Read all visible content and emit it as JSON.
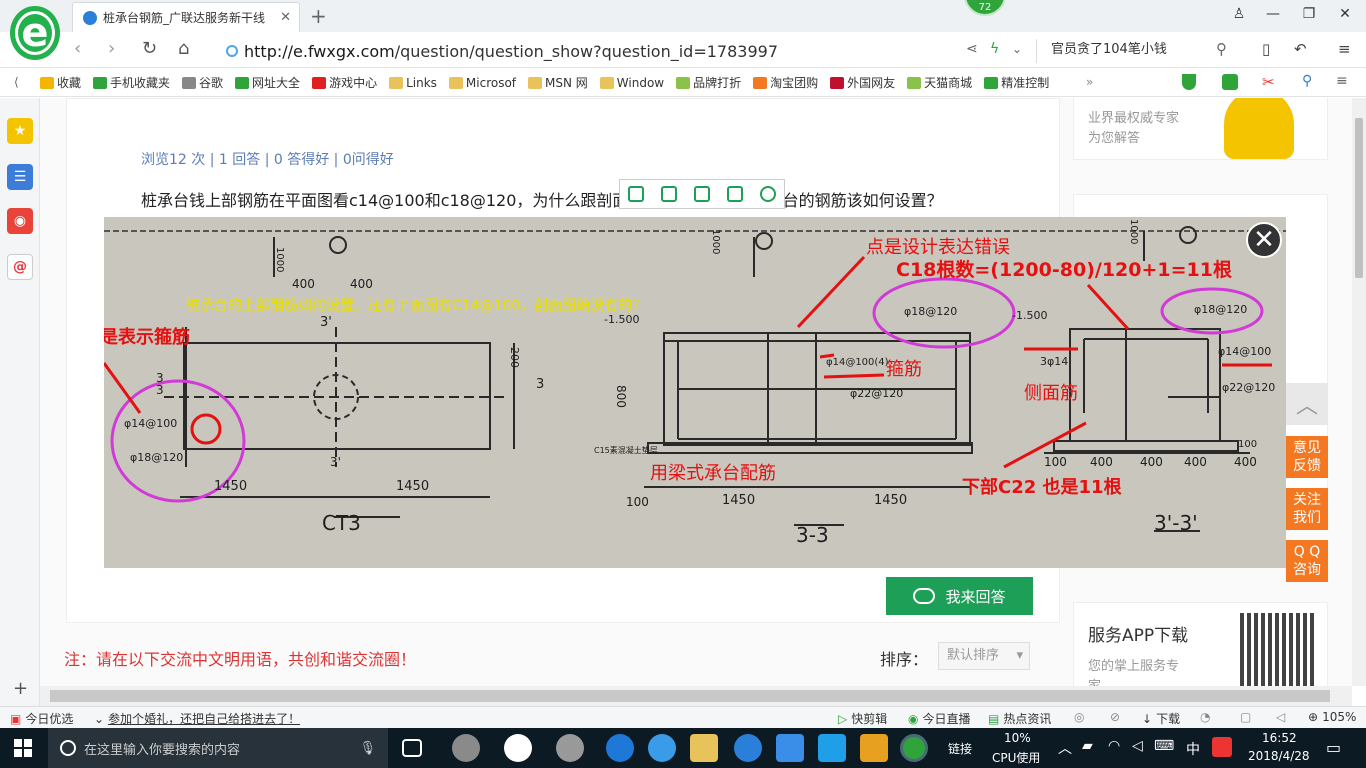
{
  "browser": {
    "tab_title": "桩承台钢筋_广联达服务新干线",
    "badge": "72",
    "url_host": "http://e.fwxgx.com",
    "url_path": "/question/question_show?question_id=1783997",
    "hot_search": "官员贪了104笔小钱"
  },
  "bookmarks": [
    {
      "label": "收藏",
      "color": "#f5b400"
    },
    {
      "label": "手机收藏夹",
      "color": "#2fa43b"
    },
    {
      "label": "谷歌",
      "color": "#888888"
    },
    {
      "label": "网址大全",
      "color": "#2fa43b"
    },
    {
      "label": "游戏中心",
      "color": "#e02020"
    },
    {
      "label": "Links",
      "color": "#e8c25a"
    },
    {
      "label": "Microsof",
      "color": "#e8c25a"
    },
    {
      "label": "MSN 网",
      "color": "#e8c25a"
    },
    {
      "label": "Window",
      "color": "#e8c25a"
    },
    {
      "label": "品牌打折",
      "color": "#8bc34a"
    },
    {
      "label": "淘宝团购",
      "color": "#f37821"
    },
    {
      "label": "外国网友",
      "color": "#c0102c"
    },
    {
      "label": "天猫商城",
      "color": "#8bc34a"
    },
    {
      "label": "精准控制",
      "color": "#2fa43b"
    }
  ],
  "question": {
    "stats": "浏览12 次 | 1 回答 | 0 答得好 | 0问得好",
    "text_left": "桩承台钱上部钢筋在平面图看c14@100和c18@120，为什么跟剖面",
    "text_right": "承台的钢筋该如何设置？",
    "answer_button": "我来回答",
    "notice": "注：请在以下交流中文明用语，共创和谐交流圈！",
    "sort_label": "排序：",
    "sort_value": "默认排序"
  },
  "right_panel": {
    "expert_line1": "业界最权威专家",
    "expert_line2": "为您解答",
    "app_title": "服务APP下载",
    "app_sub": "您的掌上服务专",
    "app_sub2": "家"
  },
  "viewer": {
    "question_banner": "桩承台的上部钢筋如何设置，还有平面图有C14@100，剖面图确没有的？",
    "annotations": {
      "stirrup_note": "这是表示箍筋",
      "design_error": "点是设计表达错误",
      "c18_count": "C18根数=(1200-80)/120+1=11根",
      "stirrup": "箍筋",
      "side_bar": "侧面筋",
      "beam_style": "用梁式承台配筋",
      "bottom_c22": "下部C22 也是11根"
    },
    "drawing_labels": {
      "d1000_a": "1000",
      "d400a": "400",
      "d400b": "400",
      "d3a": "3",
      "d31": "3'",
      "d200": "200",
      "d3b": "3",
      "d3c": "3",
      "d31b": "3'",
      "phi14_100": "φ14@100",
      "phi18_120": "φ18@120",
      "d1450a": "1450",
      "d1450b": "1450",
      "ct3": "CT3",
      "el1500a": "-1.500",
      "d800": "800",
      "phi14_100_4": "φ14@100(4)",
      "phi22_120": "φ22@120",
      "phi18_120b": "φ18@120",
      "c15": "C15素混凝土垫层",
      "d100": "100",
      "d1450c": "1450",
      "d1450d": "1450",
      "sec33": "3-3",
      "el1500b": "-1.500",
      "d3_14": "3φ14",
      "phi18_120c": "φ18@120",
      "phi14_100b": "φ14@100",
      "phi22_120b": "φ22@120",
      "d400c": "400",
      "d400d": "400",
      "d100b": "100",
      "d400e": "400",
      "d400f": "400",
      "d100c": "100",
      "sec33b": "3'-3'",
      "d1000_b": "1000",
      "d1000_c": "1000"
    }
  },
  "float_buttons": [
    "意见反馈",
    "关注我们",
    "Q Q咨询"
  ],
  "statusbar": {
    "today": "今日优选",
    "news": "参加个婚礼，还把自己给搭进去了！",
    "quick_clip": "快剪辑",
    "live": "今日直播",
    "hot_news": "热点资讯",
    "download": "下载",
    "zoom": "105%"
  },
  "taskbar": {
    "search_placeholder": "在这里输入你要搜索的内容",
    "link_label": "链接",
    "cpu_percent": "10%",
    "cpu_label": "CPU使用",
    "ime": "中",
    "time": "16:52",
    "date": "2018/4/28"
  }
}
